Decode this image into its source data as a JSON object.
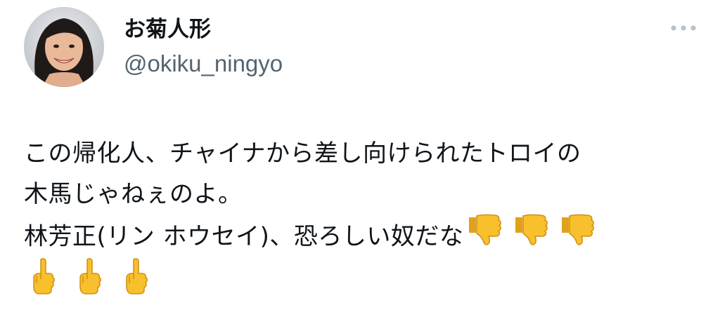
{
  "tweet": {
    "author": {
      "display_name": "お菊人形",
      "handle": "@okiku_ningyo"
    },
    "more_icon": "more-horizontal-icon",
    "text": {
      "line1": "この帰化人、チャイナから差し向けられたトロイの",
      "line2": "木馬じゃねぇのよ。",
      "line3": "林芳正(リン ホウセイ)、恐ろしい奴だな"
    },
    "emojis": {
      "thumbs_down": [
        "👎",
        "👎",
        "👎"
      ],
      "middle_finger": [
        "🖕",
        "🖕",
        "🖕"
      ]
    },
    "colors": {
      "text": "#0f1419",
      "secondary": "#536471",
      "emoji_yellow": "#f7c02c"
    }
  }
}
